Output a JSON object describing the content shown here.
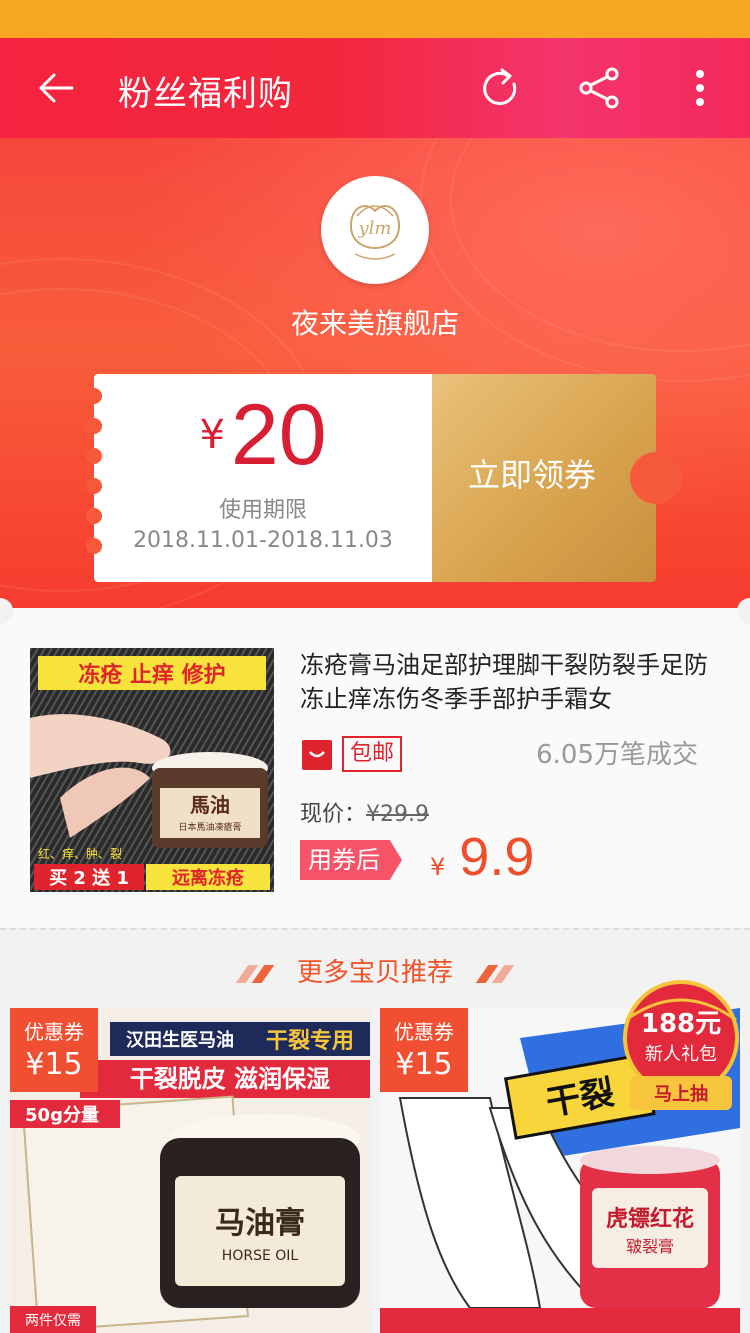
{
  "header": {
    "title": "粉丝福利购"
  },
  "store": {
    "name": "夜来美旗舰店",
    "logo_text": "ylm"
  },
  "coupon": {
    "currency": "¥",
    "amount": "20",
    "validity_label": "使用期限",
    "validity_dates": "2018.11.01-2018.11.03",
    "claim_label": "立即领券"
  },
  "product": {
    "title": "冻疮膏马油足部护理脚干裂防裂手足防冻止痒冻伤冬季手部护手霜女",
    "badge": "包邮",
    "sales": "6.05万笔成交",
    "current_price_label": "现价：",
    "current_price": "¥29.9",
    "after_coupon_label": "用券后",
    "after_coupon_currency": "¥",
    "after_coupon_price": "9.9",
    "image_text": {
      "top_banner": "冻疮 止痒 修护",
      "jar_label": "馬油",
      "jar_sub": "日本馬油凍瘡膏",
      "side_text": "红、痒、肿、裂",
      "promo_left": "买 2 送 1",
      "promo_right": "远离冻疮"
    }
  },
  "recommend": {
    "heading": "更多宝贝推荐",
    "items": [
      {
        "coupon_label": "优惠券",
        "coupon_value": "¥15",
        "banner_1": "汉田生医马油",
        "banner_2": "干裂专用",
        "banner_3": "干裂脱皮 滋润保湿",
        "size_tag": "50g分量",
        "jar_text": "马油膏",
        "jar_en": "HORSE OIL",
        "bottom_tag": "两件仅需"
      },
      {
        "coupon_label": "优惠券",
        "coupon_value": "¥15",
        "burst_text": "干裂",
        "jar_text": "虎镖红花",
        "jar_sub": "皲裂膏"
      }
    ]
  },
  "gift_popup": {
    "amount": "188元",
    "label": "新人礼包",
    "action": "马上抽"
  },
  "colors": {
    "primary_red": "#f5233f",
    "price_red": "#d81e33",
    "orange": "#f0542a",
    "gold": "#d9a44f"
  }
}
